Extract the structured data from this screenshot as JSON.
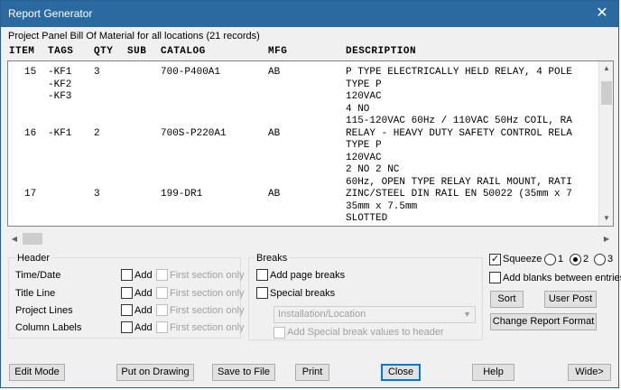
{
  "window": {
    "title": "Report Generator",
    "close_glyph": "✕"
  },
  "subtitle": "Project Panel Bill Of Material for all locations (21 records)",
  "columns": [
    "ITEM",
    "TAGS",
    "QTY",
    "SUB",
    "CATALOG",
    "MFG",
    "DESCRIPTION"
  ],
  "rows": [
    {
      "item": "15",
      "tags": [
        "-KF1",
        "-KF2",
        "-KF3"
      ],
      "qty": "3",
      "sub": "",
      "catalog": "700-P400A1",
      "mfg": "AB",
      "desc": [
        "P TYPE ELECTRICALLY HELD RELAY, 4 POLE",
        "TYPE P",
        "120VAC",
        "4 NO",
        "115-120VAC 60Hz / 110VAC 50Hz COIL, RA"
      ]
    },
    {
      "item": "16",
      "tags": [
        "-KF1"
      ],
      "qty": "2",
      "sub": "",
      "catalog": "700S-P220A1",
      "mfg": "AB",
      "desc": [
        "RELAY - HEAVY DUTY SAFETY CONTROL RELA",
        "TYPE P",
        "120VAC",
        "2 NO 2 NC",
        "60Hz, OPEN TYPE RELAY RAIL MOUNT, RATI"
      ]
    },
    {
      "item": "17",
      "tags": [],
      "qty": "3",
      "sub": "",
      "catalog": "199-DR1",
      "mfg": "AB",
      "desc": [
        "ZINC/STEEL DIN RAIL EN 50022 (35mm x 7",
        "35mm x 7.5mm",
        "SLOTTED"
      ]
    }
  ],
  "header_group": {
    "label": "Header",
    "rows": [
      {
        "label": "Time/Date",
        "add": "Add",
        "first": "First section only"
      },
      {
        "label": "Title Line",
        "add": "Add",
        "first": "First section only"
      },
      {
        "label": "Project Lines",
        "add": "Add",
        "first": "First section only"
      },
      {
        "label": "Column Labels",
        "add": "Add",
        "first": "First section only"
      }
    ]
  },
  "breaks_group": {
    "label": "Breaks",
    "page_breaks": "Add page breaks",
    "special_breaks": "Special breaks",
    "combo_value": "Installation/Location",
    "special_header": "Add Special break values to header"
  },
  "right_panel": {
    "squeeze": "Squeeze",
    "squeeze_checked": true,
    "radio_options": [
      "1",
      "2",
      "3"
    ],
    "radio_selected": "2",
    "add_blanks": "Add blanks between entries",
    "sort": "Sort",
    "user_post": "User Post",
    "change_format": "Change Report Format"
  },
  "bottom_buttons": {
    "edit_mode": "Edit Mode",
    "put_on_drawing": "Put on Drawing",
    "save_to_file": "Save to File",
    "print": "Print",
    "close": "Close",
    "help": "Help",
    "wide": "Wide>"
  },
  "colors": {
    "titlebar": "#2b6aa0",
    "dialog_bg": "#f0f0f0",
    "accent": "#0078d7"
  }
}
